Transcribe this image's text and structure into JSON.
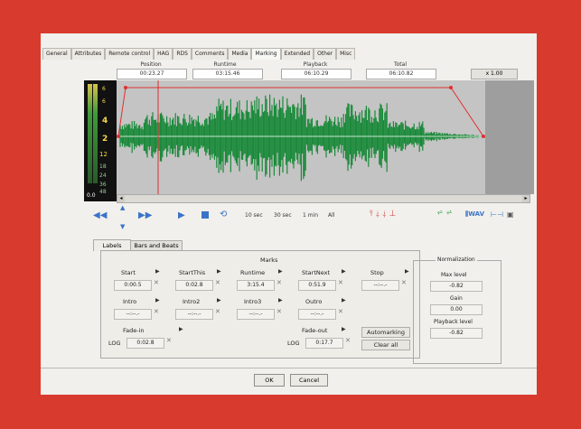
{
  "tabs": [
    "General",
    "Attributes",
    "Remote control",
    "HAG",
    "RDS",
    "Comments",
    "Media",
    "Marking",
    "Extended",
    "Other",
    "Misc"
  ],
  "active_tab": "Marking",
  "headers": {
    "position": "Position",
    "runtime": "Runtime",
    "playback": "Playback",
    "total": "Total"
  },
  "times": {
    "position": "00:23.27",
    "runtime": "03:15.46",
    "playback": "06:10.29",
    "total": "06:10.82"
  },
  "zoom": "x 1.00",
  "scale": [
    "6",
    "6",
    "4",
    "2",
    "12",
    "18",
    "24",
    "36",
    "48",
    "0.0"
  ],
  "transport": {
    "t10": "10 sec",
    "t30": "30 sec",
    "t1m": "1 min",
    "all": "All"
  },
  "section_tabs": {
    "labels": "Labels",
    "bars": "Bars and Beats"
  },
  "marks_title": "Marks",
  "marks": {
    "start": {
      "label": "Start",
      "value": "0:00.5"
    },
    "startthis": {
      "label": "StartThis",
      "value": "0:02.8"
    },
    "runtime": {
      "label": "Runtime",
      "value": "3:15.4"
    },
    "startnext": {
      "label": "StartNext",
      "value": "0:51.9"
    },
    "stop": {
      "label": "Stop",
      "value": "--:--.-"
    },
    "intro": {
      "label": "Intro",
      "value": "--:--.-"
    },
    "intro2": {
      "label": "Intro2",
      "value": "--:--.-"
    },
    "intro3": {
      "label": "Intro3",
      "value": "--:--.-"
    },
    "outro": {
      "label": "Outro",
      "value": "--:--.-"
    },
    "fadein": {
      "label": "Fade-in",
      "value": "0:02.8",
      "log": "LOG"
    },
    "fadeout": {
      "label": "Fade-out",
      "value": "0:17.7",
      "log": "LOG"
    }
  },
  "buttons": {
    "automarking": "Automarking",
    "clear_all": "Clear all",
    "ok": "OK",
    "cancel": "Cancel"
  },
  "normalization": {
    "title": "Normalization",
    "max_label": "Max level",
    "max_value": "-0.82",
    "gain_label": "Gain",
    "gain_value": "0.00",
    "playback_label": "Playback level",
    "playback_value": "-0.82"
  },
  "colors": {
    "background": "#d93a2e",
    "waveform": "#1a8a3a",
    "envelope": "#e03030",
    "transport_blue": "#3a73c8"
  },
  "icons": [
    "rewind-icon",
    "up-icon",
    "down-icon",
    "fast-forward-icon",
    "play-icon",
    "stop-icon",
    "loop-icon",
    "marker-icons",
    "waveform-icon",
    "save-icon"
  ]
}
